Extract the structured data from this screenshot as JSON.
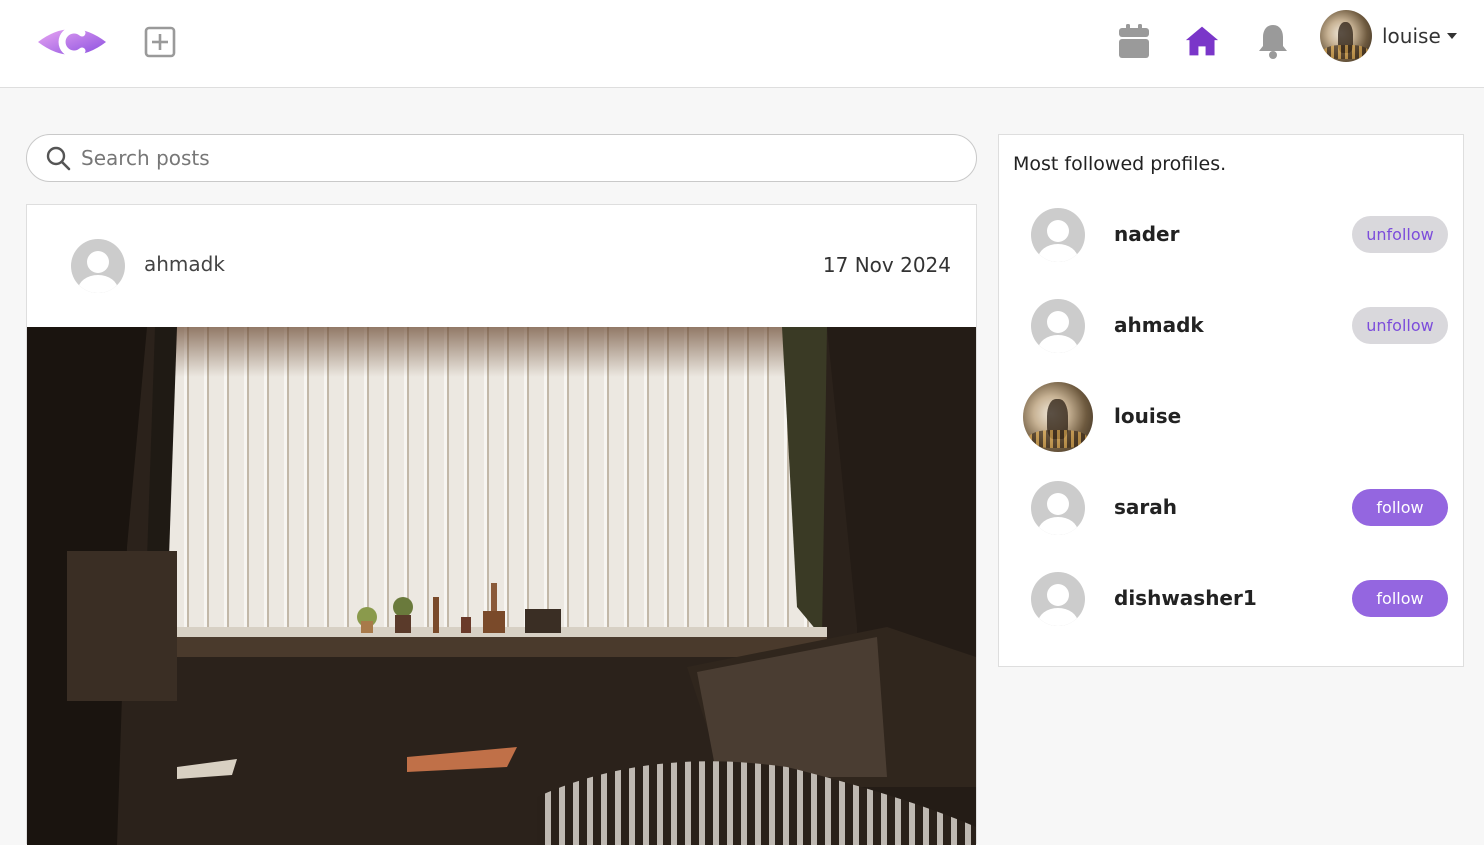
{
  "header": {
    "user_name": "louise",
    "accent_color": "#7a36c9",
    "icon_color": "#9a9a9a"
  },
  "search": {
    "placeholder": "Search posts",
    "value": ""
  },
  "post": {
    "author": "ahmadk",
    "date": "17 Nov 2024"
  },
  "sidebar": {
    "title": "Most followed profiles.",
    "profiles": [
      {
        "name": "nader",
        "action": "unfollow"
      },
      {
        "name": "ahmadk",
        "action": "unfollow"
      },
      {
        "name": "louise",
        "action": ""
      },
      {
        "name": "sarah",
        "action": "follow"
      },
      {
        "name": "dishwasher1",
        "action": "follow"
      }
    ]
  }
}
